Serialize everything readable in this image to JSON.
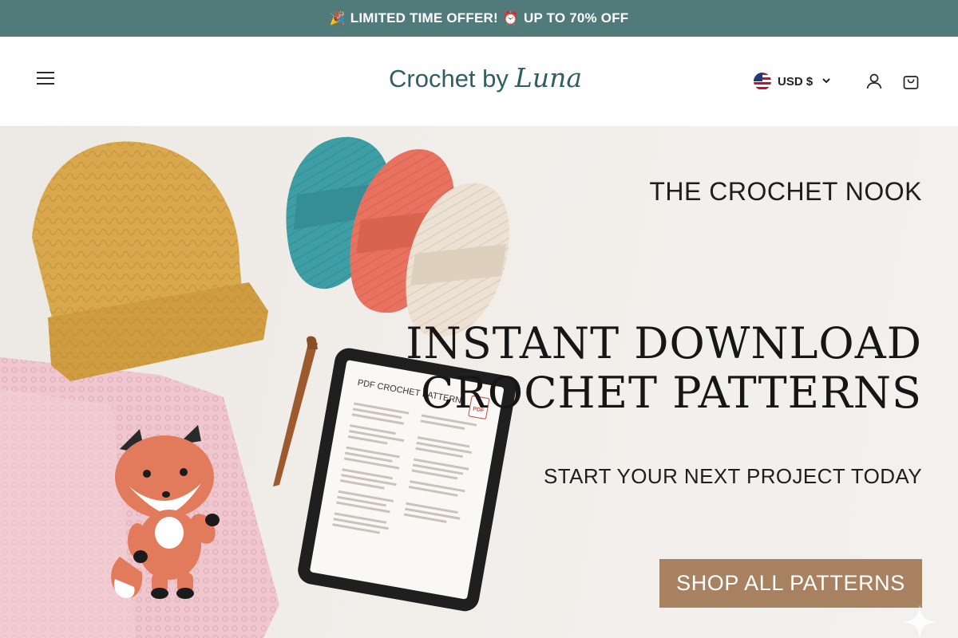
{
  "announcement": {
    "emoji_left": "🎉",
    "text_left": "LIMITED TIME OFFER!",
    "emoji_right": "⏰",
    "text_right": "UP TO 70% OFF"
  },
  "header": {
    "menu_icon": "hamburger-menu-icon",
    "logo_part1": "Crochet by",
    "logo_part2": "Luna",
    "currency_label": "USD $",
    "flag_icon": "us-flag-icon",
    "account_icon": "user-icon",
    "cart_icon": "shopping-bag-icon"
  },
  "hero": {
    "eyebrow": "THE CROCHET NOOK",
    "title_line1": "INSTANT DOWNLOAD",
    "title_line2": "CROCHET PATTERNS",
    "subtitle": "START YOUR NEXT PROJECT TODAY",
    "cta_label": "SHOP ALL PATTERNS",
    "tablet_heading": "PDF CROCHET PATTERN",
    "tablet_badge": "PDF"
  },
  "colors": {
    "announcement_bg": "#517b7a",
    "logo": "#2f5f63",
    "cta_bg": "#a88260",
    "beanie": "#d9a84c",
    "yarn_teal": "#3e9ea6",
    "yarn_coral": "#e8725f",
    "yarn_cream": "#ece1d2",
    "blanket": "#f0c7cf",
    "fox": "#e27a5c"
  }
}
